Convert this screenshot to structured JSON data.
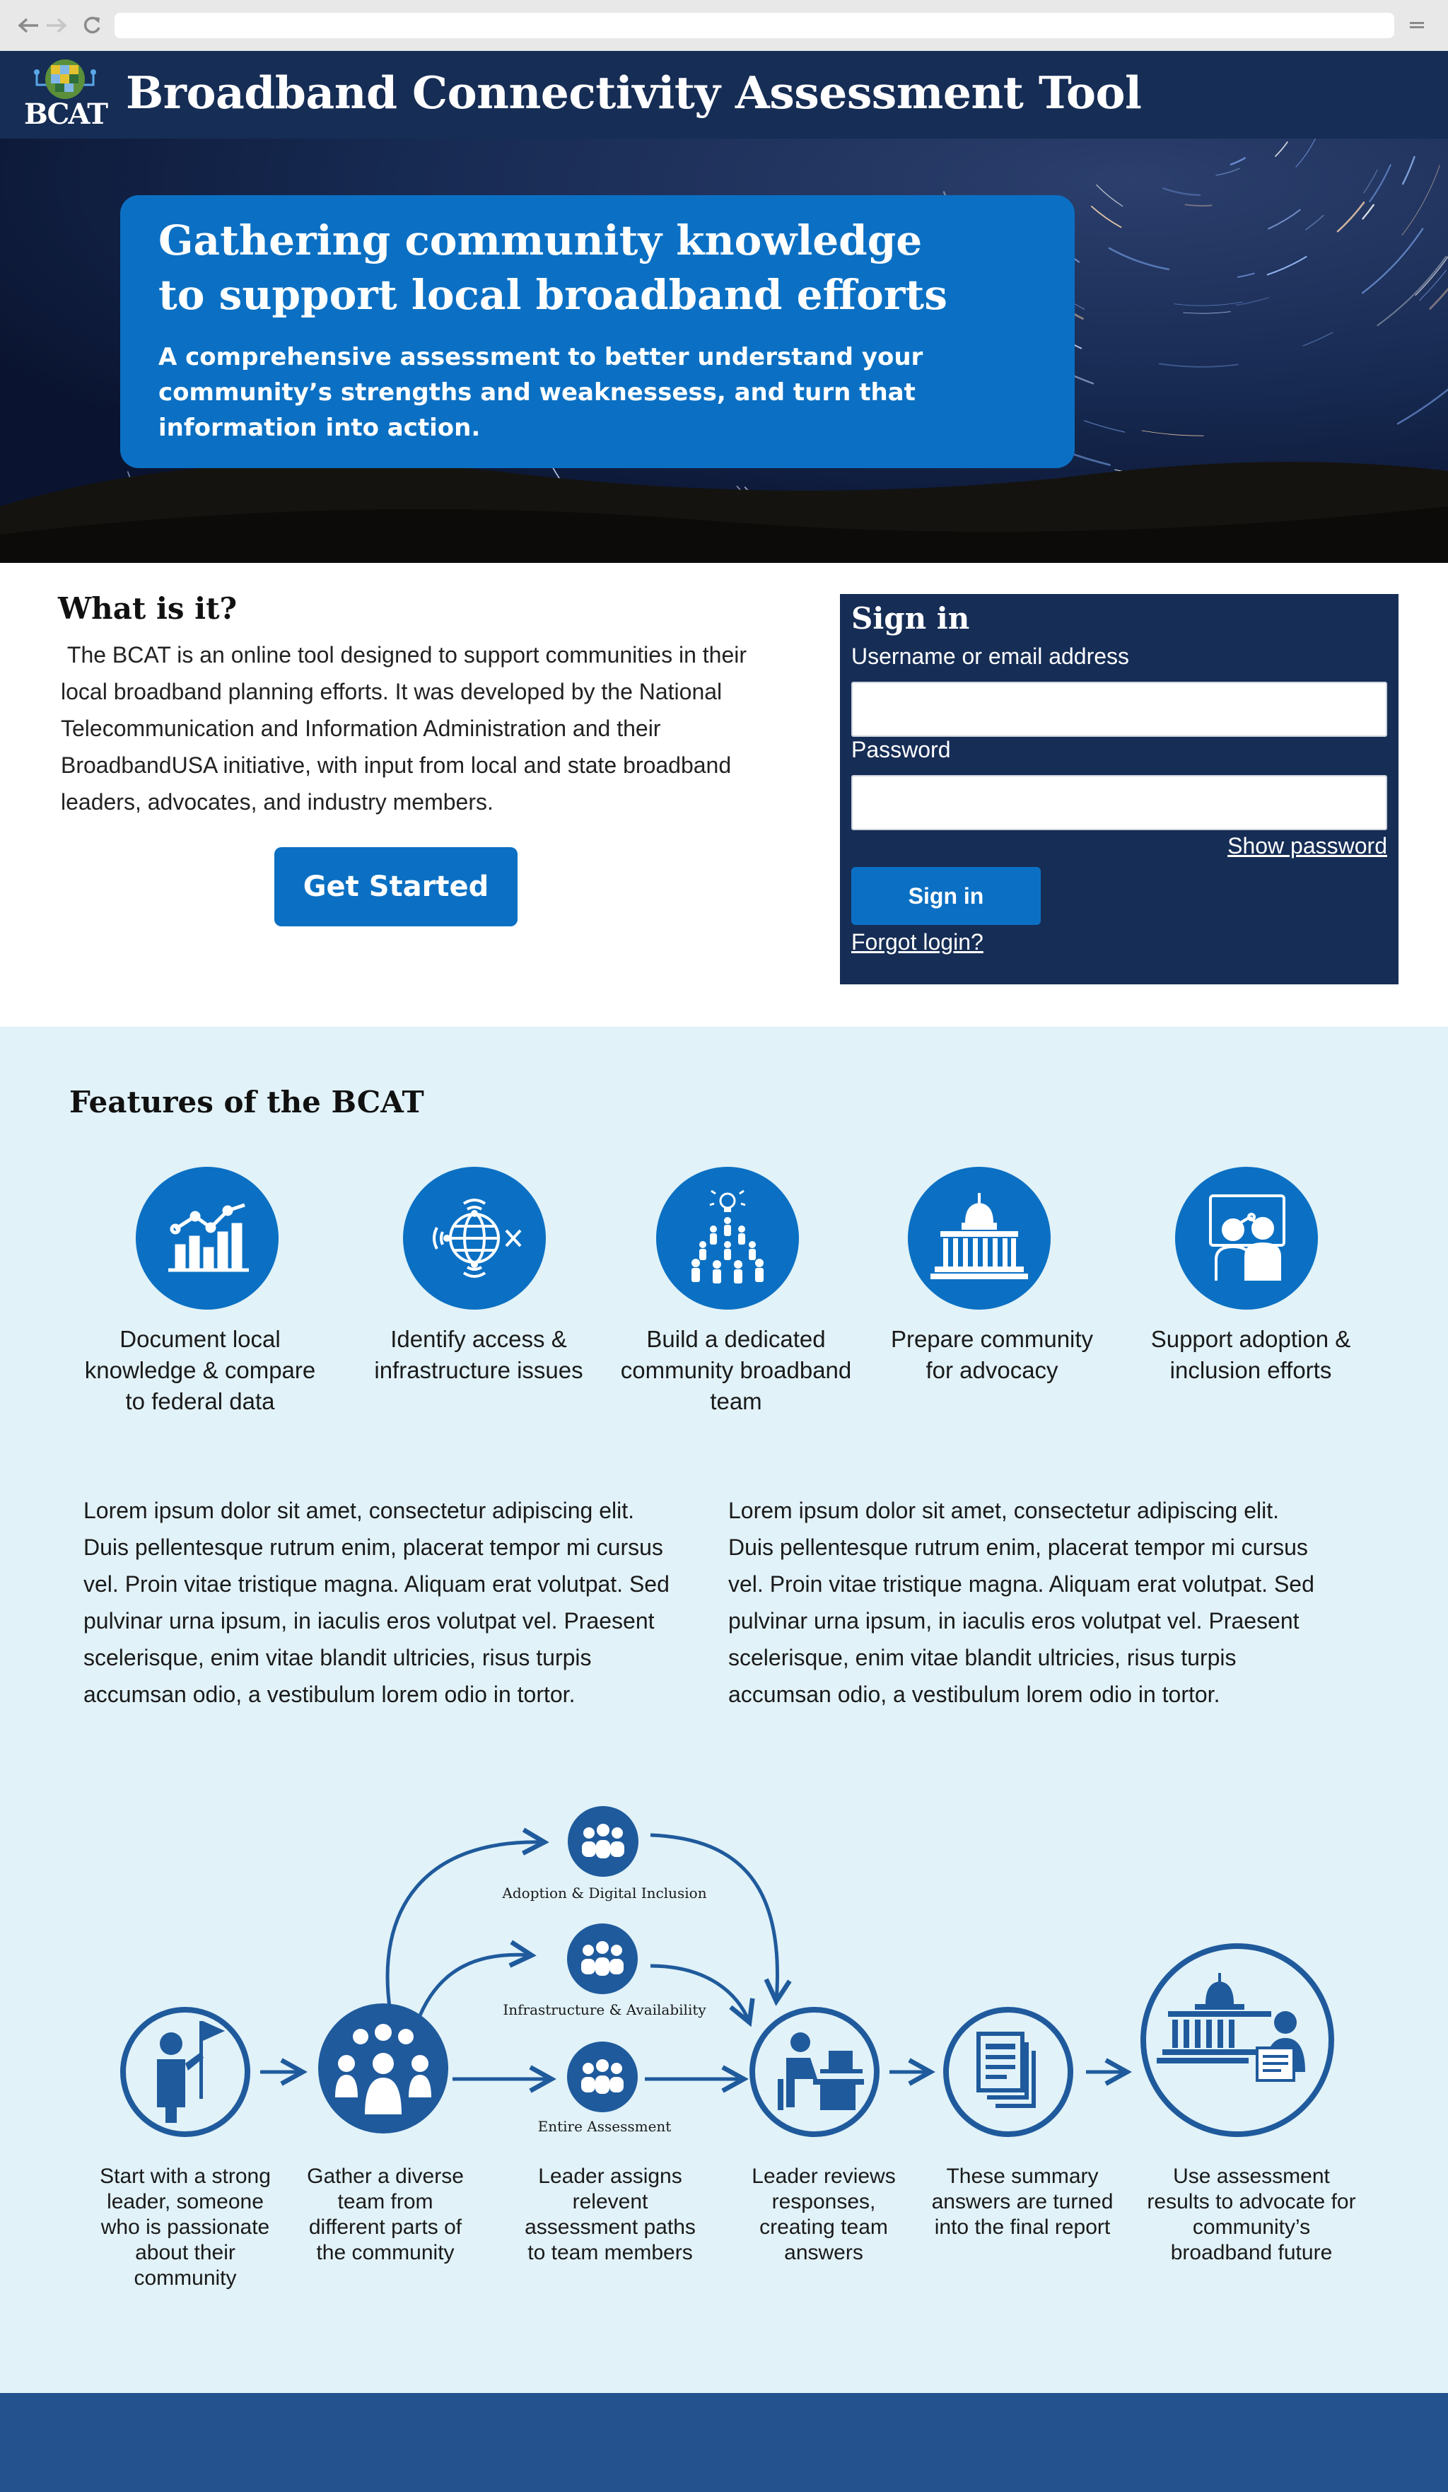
{
  "header": {
    "logo_text": "BCAT",
    "site_title": "Broadband Connectivity Assessment Tool"
  },
  "hero": {
    "heading_line1": "Gathering community knowledge",
    "heading_line2": "to support local broadband efforts",
    "subheading": "A comprehensive assessment to better understand your community’s strengths and weaknessess, and turn that information into action."
  },
  "about": {
    "title": "What is it?",
    "body": " The BCAT is an online tool designed to support communities in their local broadband planning efforts. It was developed by the National Telecommunication and Information Administration and their BroadbandUSA initiative, with input from local and state broadband leaders, advocates, and industry members.",
    "cta_label": "Get Started"
  },
  "signin": {
    "title": "Sign in",
    "username_label": "Username or email address",
    "username_value": "",
    "password_label": "Password",
    "password_value": "",
    "show_password_label": "Show password",
    "submit_label": "Sign in",
    "forgot_label": "Forgot login?"
  },
  "features": {
    "title": "Features of the BCAT",
    "items": [
      {
        "label": "Document local knowledge & compare to federal data",
        "icon": "chart-icon"
      },
      {
        "label": "Identify access & infrastructure issues",
        "icon": "globe-wireless-icon"
      },
      {
        "label": "Build a dedicated community broadband team",
        "icon": "team-idea-icon"
      },
      {
        "label": "Prepare community for advocacy",
        "icon": "capitol-icon"
      },
      {
        "label": "Support adoption & inclusion efforts",
        "icon": "classroom-icon"
      }
    ],
    "paragraphs": [
      "Lorem ipsum dolor sit amet, consectetur adipiscing elit. Duis pellentesque rutrum enim, placerat tempor mi cursus vel. Proin vitae tristique magna. Aliquam erat volutpat. Sed pulvinar urna ipsum, in iaculis eros volutpat vel. Praesent scelerisque, enim vitae blandit ultricies, risus turpis accumsan odio, a vestibulum lorem odio in tortor.",
      "Lorem ipsum dolor sit amet, consectetur adipiscing elit. Duis pellentesque rutrum enim, placerat tempor mi cursus vel. Proin vitae tristique magna. Aliquam erat volutpat. Sed pulvinar urna ipsum, in iaculis eros volutpat vel. Praesent scelerisque, enim vitae blandit ultricies, risus turpis accumsan odio, a vestibulum lorem odio in tortor."
    ]
  },
  "process": {
    "paths": [
      "Adoption & Digital Inclusion",
      "Infrastructure & Availability",
      "Entire Assessment"
    ],
    "steps": [
      "Start with a strong leader, someone who is passionate about their community",
      "Gather a diverse team from different parts of the community",
      "Leader assigns relevent assessment paths to team members",
      "Leader reviews responses, creating team answers",
      "These summary answers are turned into the final report",
      "Use assessment results to advocate for community’s broadband future"
    ]
  },
  "colors": {
    "navy": "#162d55",
    "brand_blue": "#0b70c3",
    "icon_blue": "#1f5a9c",
    "features_bg": "#e1f2f8",
    "footer": "#23528f"
  }
}
